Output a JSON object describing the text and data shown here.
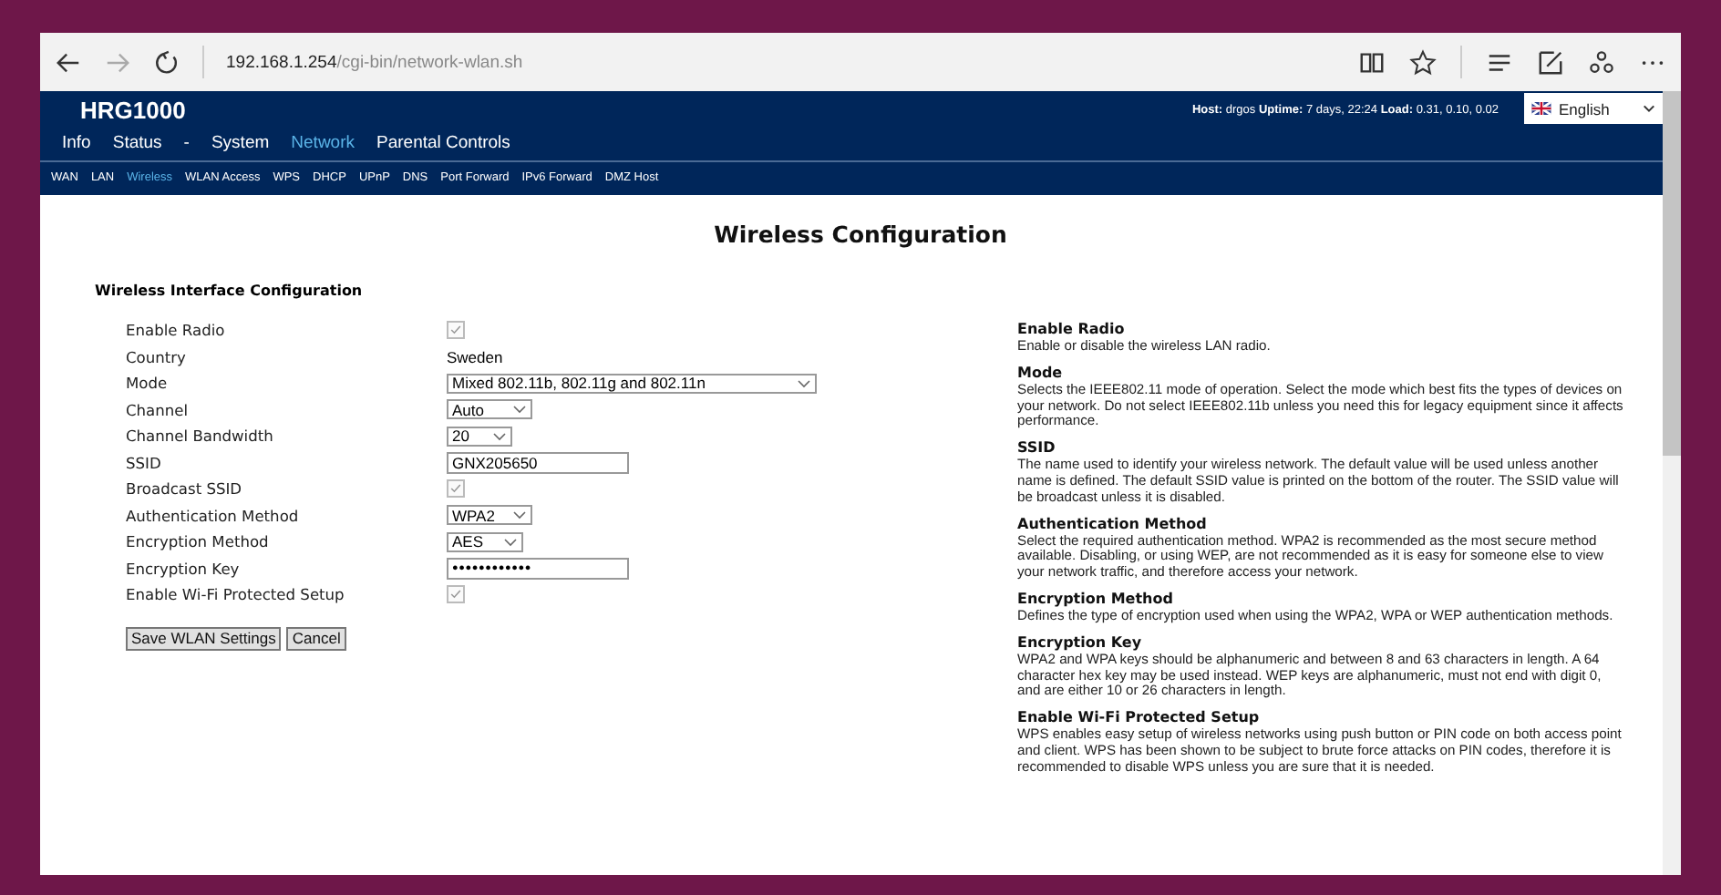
{
  "browser": {
    "url_host": "192.168.1.254",
    "url_path": "/cgi-bin/network-wlan.sh"
  },
  "header": {
    "title": "HRG1000",
    "status": "**Host:** drgos **Uptime:** 7 days, 22:24 **Load:** 0.31, 0.10, 0.02",
    "language": "English"
  },
  "menu": [
    {
      "label": "Info",
      "selected": false
    },
    {
      "label": "Status",
      "selected": false
    },
    {
      "label": "-",
      "selected": false
    },
    {
      "label": "System",
      "selected": false
    },
    {
      "label": "Network",
      "selected": true
    },
    {
      "label": "Parental Controls",
      "selected": false
    }
  ],
  "submenu": [
    {
      "label": "WAN",
      "selected": false
    },
    {
      "label": "LAN",
      "selected": false
    },
    {
      "label": "Wireless",
      "selected": true
    },
    {
      "label": "WLAN Access",
      "selected": false
    },
    {
      "label": "WPS",
      "selected": false
    },
    {
      "label": "DHCP",
      "selected": false
    },
    {
      "label": "UPnP",
      "selected": false
    },
    {
      "label": "DNS",
      "selected": false
    },
    {
      "label": "Port Forward",
      "selected": false
    },
    {
      "label": "IPv6 Forward",
      "selected": false
    },
    {
      "label": "DMZ Host",
      "selected": false
    }
  ],
  "page_title": "Wireless Configuration",
  "section_title": "Wireless Interface Configuration",
  "fields": [
    {
      "label": "Enable Radio",
      "kind": "checkbox",
      "checked": true
    },
    {
      "label": "Country",
      "kind": "text",
      "value": "Sweden"
    },
    {
      "label": "Mode",
      "kind": "select",
      "value": "Mixed 802.11b, 802.11g and 802.11n"
    },
    {
      "label": "Channel",
      "kind": "select",
      "value": "Auto"
    },
    {
      "label": "Channel Bandwidth",
      "kind": "select",
      "value": "20"
    },
    {
      "label": "SSID",
      "kind": "input",
      "value": "GNX205650"
    },
    {
      "label": "Broadcast SSID",
      "kind": "checkbox",
      "checked": true
    },
    {
      "label": "Authentication Method",
      "kind": "select",
      "value": "WPA2"
    },
    {
      "label": "Encryption Method",
      "kind": "select",
      "value": "AES"
    },
    {
      "label": "Encryption Key",
      "kind": "password",
      "value": "●●●●●●●●●●●●"
    },
    {
      "label": "Enable Wi-Fi Protected Setup",
      "kind": "checkbox",
      "checked": true
    }
  ],
  "buttons": [
    "Save WLAN Settings",
    "Cancel"
  ],
  "help": [
    {
      "title": "Enable Radio",
      "text": "Enable or disable the wireless LAN radio."
    },
    {
      "title": "Mode",
      "text": "Selects the IEEE802.11 mode of operation. Select the mode which best fits the types of devices on your network. Do not select IEEE802.11b unless you need this for legacy equipment since it affects performance."
    },
    {
      "title": "SSID",
      "text": "The name used to identify your wireless network. The default value will be used unless another name is defined. The default SSID value is printed on the bottom of the router. The SSID value will be broadcast unless it is disabled."
    },
    {
      "title": "Authentication Method",
      "text": "Select the required authentication method. WPA2 is recommended as the most secure method available. Disabling, or using WEP, are not recommended as it is easy for someone else to view your network traffic, and therefore access your network."
    },
    {
      "title": "Encryption Method",
      "text": "Defines the type of encryption used when using the WPA2, WPA or WEP authentication methods."
    },
    {
      "title": "Encryption Key",
      "text": "WPA2 and WPA keys should be alphanumeric and between 8 and 63 characters in length. A 64 character hex key may be used instead. WEP keys are alphanumeric, must not end with digit 0, and are either 10 or 26 characters in length."
    },
    {
      "title": "Enable Wi-Fi Protected Setup",
      "text": "WPS enables easy setup of wireless networks using push button or PIN code on both access point and client. WPS has been shown to be subject to brute force attacks on PIN codes, therefore it is recommended to disable WPS unless you are sure that it is needed."
    }
  ]
}
